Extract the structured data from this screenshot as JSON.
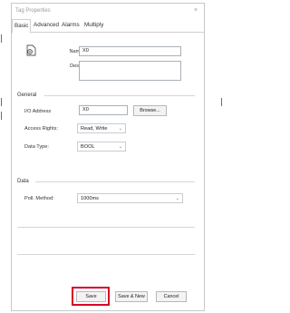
{
  "window": {
    "title": "Tag Properties",
    "close_glyph": "×"
  },
  "tabs": [
    {
      "label": "Basic",
      "active": true
    },
    {
      "label": "Advanced",
      "active": false
    },
    {
      "label": "Alarms",
      "active": false
    },
    {
      "label": "Multiply",
      "active": false
    }
  ],
  "basic": {
    "icon": "tag-icon",
    "name_label": "Name:",
    "name_value": "X0",
    "desc_label": "Desc.:",
    "desc_value": ""
  },
  "general": {
    "section_title": "General",
    "io_address_label": "I/O Address",
    "io_address_value": "X0",
    "browse_label": "Browse...",
    "access_rights_label": "Access Rights:",
    "access_rights_value": "Read, Write",
    "data_type_label": "Data Type:",
    "data_type_value": "BOOL"
  },
  "data": {
    "section_title": "Data",
    "poll_method_label": "Poll. Method:",
    "poll_method_value": "1000ms"
  },
  "footer": {
    "save_label": "Save",
    "save_new_label": "Save & New",
    "cancel_label": "Cancel"
  },
  "colors": {
    "highlight": "#d80027",
    "border": "#c8c8c8"
  }
}
